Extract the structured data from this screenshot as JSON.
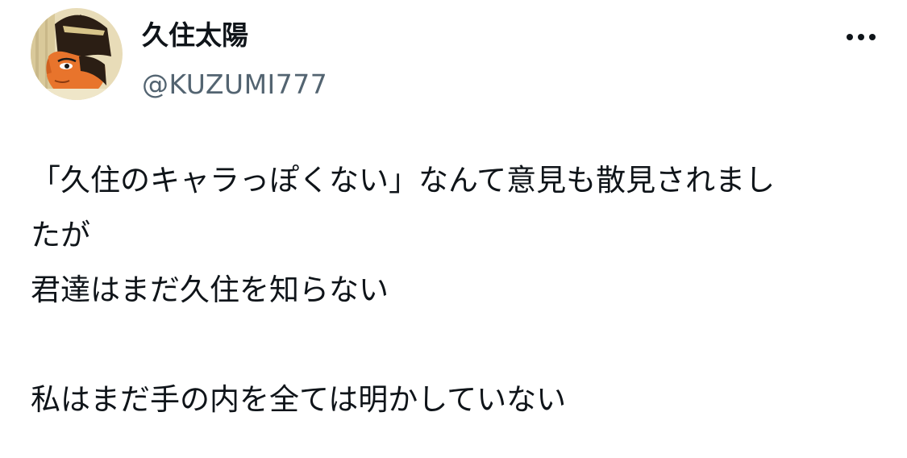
{
  "author": {
    "display_name": "久住太陽",
    "handle": "@KUZUMI777",
    "avatar_icon": "profile-avatar-icon"
  },
  "actions": {
    "more_icon": "more-horizontal-icon"
  },
  "tweet": {
    "lines": [
      "「久住のキャラっぽくない」なんて意見も散見されまし",
      "たが",
      "君達はまだ久住を知らない",
      "",
      "私はまだ手の内を全ては明かしていない"
    ]
  },
  "colors": {
    "text_primary": "#0f1419",
    "text_secondary": "#536471",
    "background": "#ffffff"
  }
}
